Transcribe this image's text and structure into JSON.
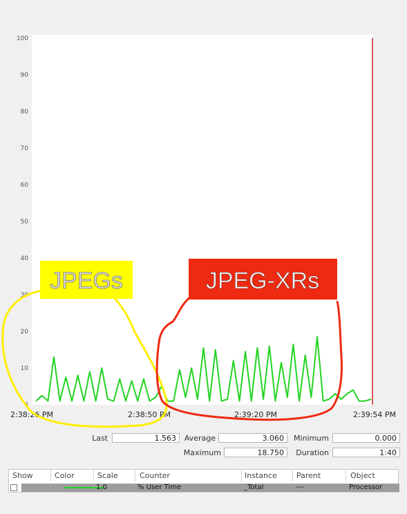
{
  "chart_data": {
    "type": "line",
    "ylim": [
      0,
      100
    ],
    "yticks": [
      "100",
      "90",
      "80",
      "70",
      "60",
      "50",
      "40",
      "30",
      "20",
      "10",
      "0"
    ],
    "x_tick_labels": [
      "2:38:26 PM",
      "2:38:50 PM",
      "2:39:20 PM",
      "2:39:54 PM"
    ],
    "series": [
      {
        "color": "#22d322",
        "values": [
          1,
          2.5,
          1,
          13,
          1,
          7.5,
          1,
          8,
          1,
          9,
          1,
          10,
          1.5,
          1,
          7,
          1,
          6.5,
          1,
          7,
          1,
          2,
          5,
          1,
          1,
          9.5,
          2,
          10,
          1.5,
          15.5,
          1,
          15,
          1,
          1.5,
          12,
          1,
          14.5,
          1,
          15.5,
          1.5,
          16,
          1,
          11.5,
          2,
          16.5,
          1,
          13.5,
          2,
          18.5,
          1,
          1.5,
          3,
          1.5,
          3,
          4,
          1,
          1,
          1.5
        ]
      }
    ],
    "annotations": [
      {
        "text": "JPEGs",
        "background": "#ffff00",
        "text_color": "#d8d8d8",
        "outline_color": "#ffee00"
      },
      {
        "text": "JPEG-XRs",
        "background": "#ee2a12",
        "text_color": "#f2f2f2",
        "outline_color": "#ee2a12"
      }
    ]
  },
  "stats": {
    "last_label": "Last",
    "last_value": "1.563",
    "average_label": "Average",
    "average_value": "3.060",
    "minimum_label": "Minimum",
    "minimum_value": "0.000",
    "maximum_label": "Maximum",
    "maximum_value": "18.750",
    "duration_label": "Duration",
    "duration_value": "1:40"
  },
  "legend": {
    "headers": [
      "Show",
      "Color",
      "Scale",
      "Counter",
      "Instance",
      "Parent",
      "Object"
    ],
    "row": {
      "scale": "1.0",
      "counter": "% User Time",
      "instance": "_Total",
      "parent": "---",
      "object": "Processor"
    }
  }
}
